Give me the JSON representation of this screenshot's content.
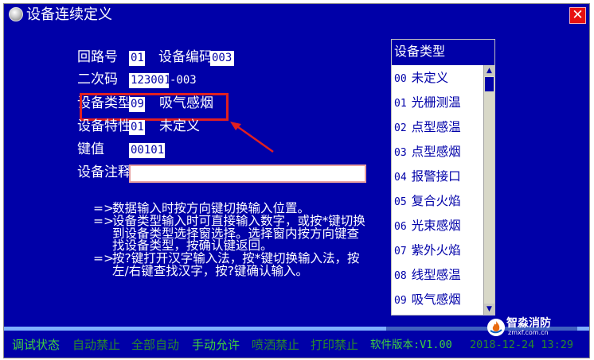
{
  "window": {
    "title": "设备连续定义",
    "close_icon": "close-icon",
    "icon": "app-icon"
  },
  "form": {
    "loop_label": "回路号",
    "loop_value": "01",
    "device_code_label": "设备编码",
    "device_code_value": "003",
    "secondary_code_label": "二次码",
    "secondary_code_value": "123001",
    "secondary_code_suffix": "-003",
    "device_type_label": "设备类型",
    "device_type_value": "09",
    "device_type_name": "吸气感烟",
    "device_feature_label": "设备特性",
    "device_feature_value": "01",
    "device_feature_name": "未定义",
    "key_value_label": "键值",
    "key_value_value": "00101",
    "device_note_label": "设备注释",
    "device_note_value": ""
  },
  "notes": [
    {
      "marker": "=>",
      "lines": [
        "数据输入时按方向键切换输入位置。"
      ]
    },
    {
      "marker": "=>",
      "lines": [
        "设备类型输入时可直接输入数字，或按*键切换",
        "到设备类型选择窗选择。选择窗内按方向键查",
        "找设备类型，按确认键返回。"
      ]
    },
    {
      "marker": "=>",
      "lines": [
        "按?键打开汉字输入法，按*键切换输入法，按",
        "左/右键查找汉字，按?键确认输入。"
      ]
    }
  ],
  "device_type_list": {
    "header": "设备类型",
    "items": [
      {
        "num": "00",
        "name": "未定义"
      },
      {
        "num": "01",
        "name": "光栅测温"
      },
      {
        "num": "02",
        "name": "点型感温"
      },
      {
        "num": "03",
        "name": "点型感烟"
      },
      {
        "num": "04",
        "name": "报警接口"
      },
      {
        "num": "05",
        "name": "复合火焰"
      },
      {
        "num": "06",
        "name": "光束感烟"
      },
      {
        "num": "07",
        "name": "紫外火焰"
      },
      {
        "num": "08",
        "name": "线型感温"
      },
      {
        "num": "09",
        "name": "吸气感烟"
      }
    ]
  },
  "status_bar": {
    "debug_state": "调试状态",
    "auto_disabled": "自动禁止",
    "all_auto": "全部自动",
    "manual_allowed": "手动允许",
    "spray_disabled": "喷洒禁止",
    "print_disabled": "打印禁止",
    "software_version": "软件版本:V1.00",
    "datetime": "2018-12-24 13:29"
  },
  "watermark": {
    "title": "智淼消防",
    "subtitle": "zmxf.com.cn"
  },
  "colors": {
    "background": "#0000a8",
    "highlight": "#e02020",
    "status_green": "#3ecf3e"
  }
}
